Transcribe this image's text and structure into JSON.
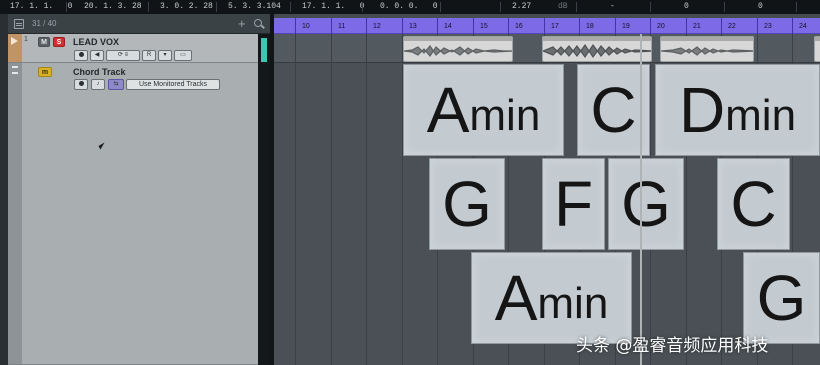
{
  "topbar": {
    "fields": [
      "17. 1. 1.   0",
      "20. 1. 3. 28",
      "3. 0. 2. 28",
      "5. 3. 3.104",
      "17. 1. 1.   0",
      "0. 0. 0.   0",
      "2.27",
      "dB",
      "-",
      "0",
      "0"
    ]
  },
  "track_list": {
    "track_count": "31 / 40",
    "tracks": [
      {
        "number": "1",
        "name": "LEAD VOX",
        "mute_label": "M",
        "solo_label": "S",
        "read_label": "R",
        "write_label": "W"
      },
      {
        "name": "Chord Track",
        "mute_label": "m",
        "mode_label": "Use Monitored Tracks"
      }
    ]
  },
  "ruler": {
    "bars": [
      "10",
      "11",
      "12",
      "13",
      "14",
      "15",
      "16",
      "17",
      "18",
      "19",
      "20",
      "21",
      "22",
      "23",
      "24"
    ]
  },
  "chords": [
    {
      "root": "A",
      "quality": "min"
    },
    {
      "root": "C",
      "quality": ""
    },
    {
      "root": "D",
      "quality": "min"
    },
    {
      "root": "G",
      "quality": ""
    },
    {
      "root": "F",
      "quality": ""
    },
    {
      "root": "G",
      "quality": ""
    },
    {
      "root": "C",
      "quality": ""
    },
    {
      "root": "A",
      "quality": "min"
    },
    {
      "root": "G",
      "quality": ""
    }
  ],
  "watermark": "头条 @盈睿音频应用科技",
  "colors": {
    "ruler": "#7c6ae6",
    "solo": "#cf3131",
    "monitor": "#d7b02a",
    "chord_block": "#c3cbd1",
    "track_color": "#c09466"
  }
}
